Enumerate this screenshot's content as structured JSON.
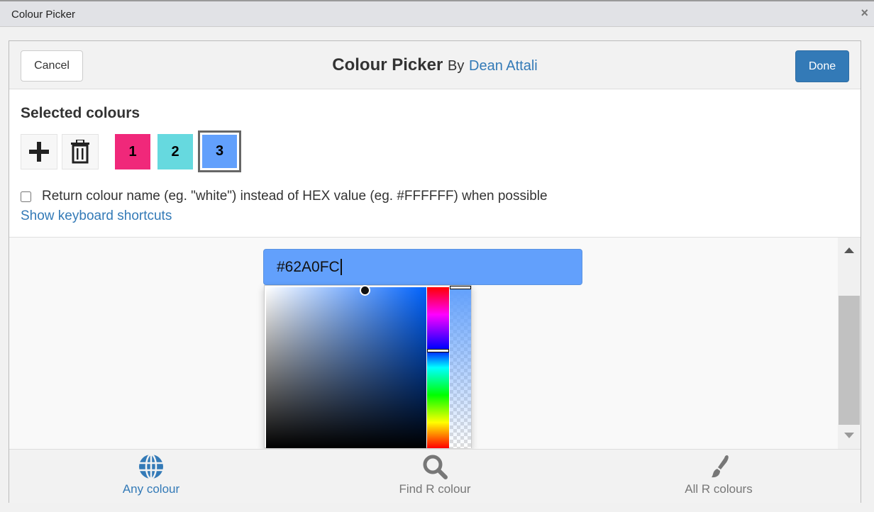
{
  "window": {
    "title": "Colour Picker",
    "close": "×"
  },
  "header": {
    "cancel": "Cancel",
    "done": "Done",
    "title": "Colour Picker",
    "by": "By",
    "author": "Dean Attali"
  },
  "selected": {
    "heading": "Selected colours",
    "swatches": [
      {
        "label": "1",
        "color": "#F0287A"
      },
      {
        "label": "2",
        "color": "#66D9DF"
      },
      {
        "label": "3",
        "color": "#62A0FC",
        "active": true
      }
    ]
  },
  "options": {
    "return_name": "Return colour name (eg. \"white\") instead of HEX value (eg. #FFFFFF) when possible",
    "return_name_checked": false,
    "shortcuts": "Show keyboard shortcuts"
  },
  "picker": {
    "hex": "#62A0FC"
  },
  "tabs": [
    {
      "label": "Any colour",
      "icon": "globe-icon",
      "active": true
    },
    {
      "label": "Find R colour",
      "icon": "search-icon"
    },
    {
      "label": "All R colours",
      "icon": "paintbrush-icon"
    }
  ]
}
